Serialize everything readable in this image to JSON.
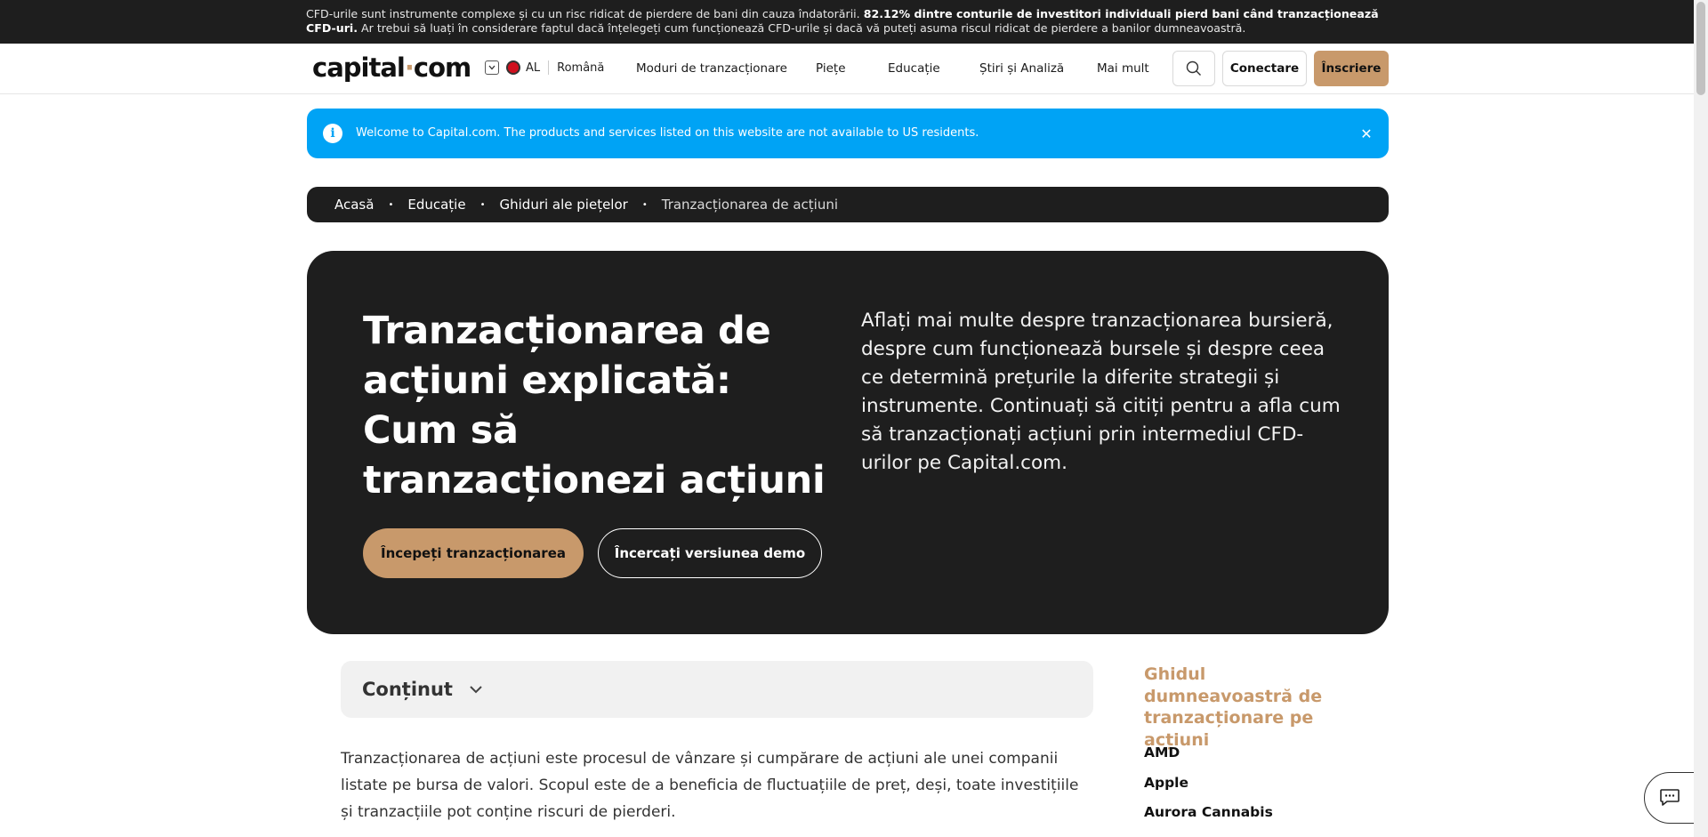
{
  "risk_warning": {
    "text_start": "CFD-urile sunt instrumente complexe și cu un risc ridicat de pierdere de bani din cauza îndatorării. ",
    "text_bold": "82.12% dintre conturile de investitori individuali pierd bani când tranzacționează CFD-uri.",
    "text_end": " Ar trebui să luați în considerare faptul dacă înțelegeți cum funcționează CFD-urile și dacă vă puteți asuma riscul ridicat de pierdere a banilor dumneavoastră."
  },
  "header": {
    "logo_left": "capital",
    "logo_dot": "·",
    "logo_right": "com",
    "region_code": "AL",
    "language": "Română",
    "nav": [
      "Moduri de tranzacționare",
      "Piețe",
      "Educație",
      "Știri și Analiză",
      "Mai mult"
    ],
    "login_label": "Conectare",
    "signup_label": "Înscriere"
  },
  "notice": {
    "text": "Welcome to Capital.com. The products and services listed on this website are not available to US residents.",
    "close_glyph": "✕"
  },
  "breadcrumb": {
    "items": [
      "Acasă",
      "Educație",
      "Ghiduri ale piețelor"
    ],
    "current": "Tranzacționarea de acțiuni",
    "separator": "•"
  },
  "hero": {
    "title": "Tranzacționarea de acțiuni explicată: Cum să tranzacționezi acțiuni",
    "description": "Aflați mai multe despre tranzacționarea bursieră, despre cum funcționează bursele și despre ceea ce determină prețurile la diferite strategii și instrumente. Continuați să citiți pentru a afla cum să tranzacționați acțiuni prin intermediul CFD-urilor pe Capital.com.",
    "primary_cta": "Începeți tranzacționarea",
    "secondary_cta": "Încercați versiunea demo"
  },
  "contents": {
    "label": "Conținut"
  },
  "article": {
    "intro": "Tranzacționarea de acțiuni este procesul de vânzare și cumpărare de acțiuni ale unei companii listate pe bursa de valori. Scopul este de a beneficia de fluctuațiile de preț, deși, toate investițiile și tranzacțiile pot conține riscuri de pierderi."
  },
  "sidebar": {
    "title": "Ghidul dumneavoastră de tranzacționare pe acțiuni",
    "items": [
      "AMD",
      "Apple",
      "Aurora Cannabis"
    ]
  },
  "colors": {
    "accent": "#c8996b",
    "notice_blue": "#00a3f5",
    "dark": "#1e1e1e"
  }
}
